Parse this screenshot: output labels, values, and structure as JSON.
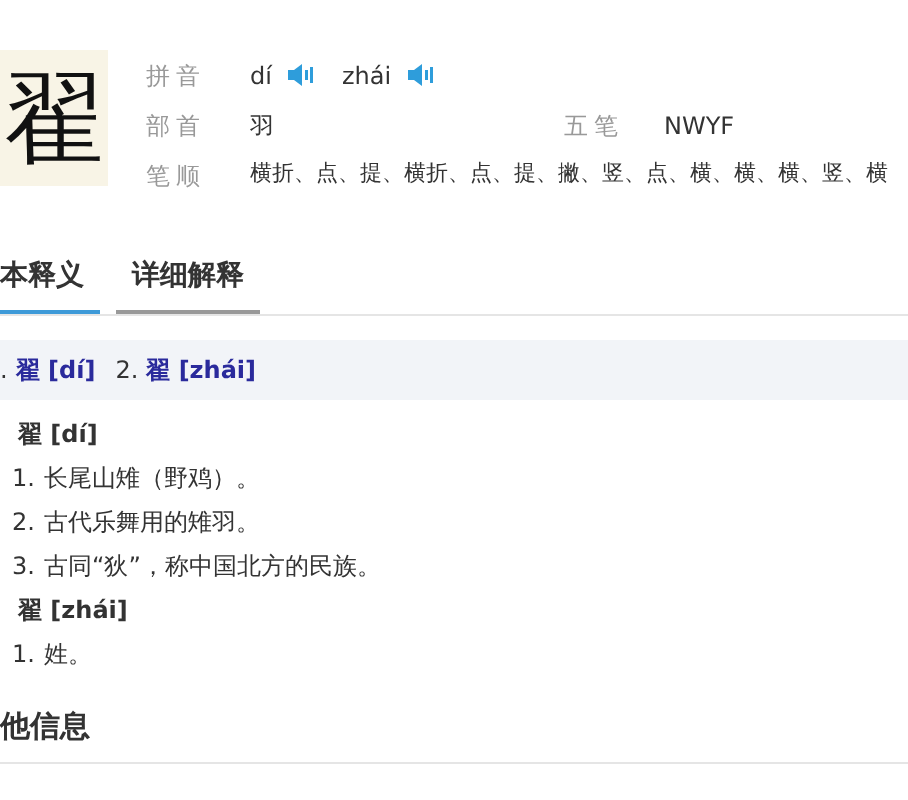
{
  "headword": "翟",
  "info": [
    {
      "label": "拼音",
      "kind": "pinyin",
      "readings": [
        "dí",
        "zhái"
      ]
    },
    {
      "label": "部首",
      "kind": "pair",
      "value": "羽",
      "label2": "五笔",
      "value2": "NWYF"
    },
    {
      "label": "笔顺",
      "kind": "text",
      "value": "横折、点、提、横折、点、提、撇、竖、点、横、横、横、竖、横"
    }
  ],
  "tabs": [
    {
      "label": "本释义",
      "selected": true
    },
    {
      "label": "详细解释",
      "selected": false
    }
  ],
  "reading_links": [
    {
      "number": ".",
      "link": "翟 [dí]"
    },
    {
      "number": "2.",
      "link": "翟 [zhái]"
    }
  ],
  "senses": [
    {
      "heading": "翟 [dí]",
      "items": [
        {
          "number": "1.",
          "text": "长尾山雉（野鸡）。"
        },
        {
          "number": "2.",
          "text": "古代乐舞用的雉羽。"
        },
        {
          "number": "3.",
          "text": "古同“狄”，称中国北方的民族。"
        }
      ]
    },
    {
      "heading": "翟 [zhái]",
      "items": [
        {
          "number": "1.",
          "text": "姓。"
        }
      ]
    }
  ],
  "section_title": "他信息"
}
